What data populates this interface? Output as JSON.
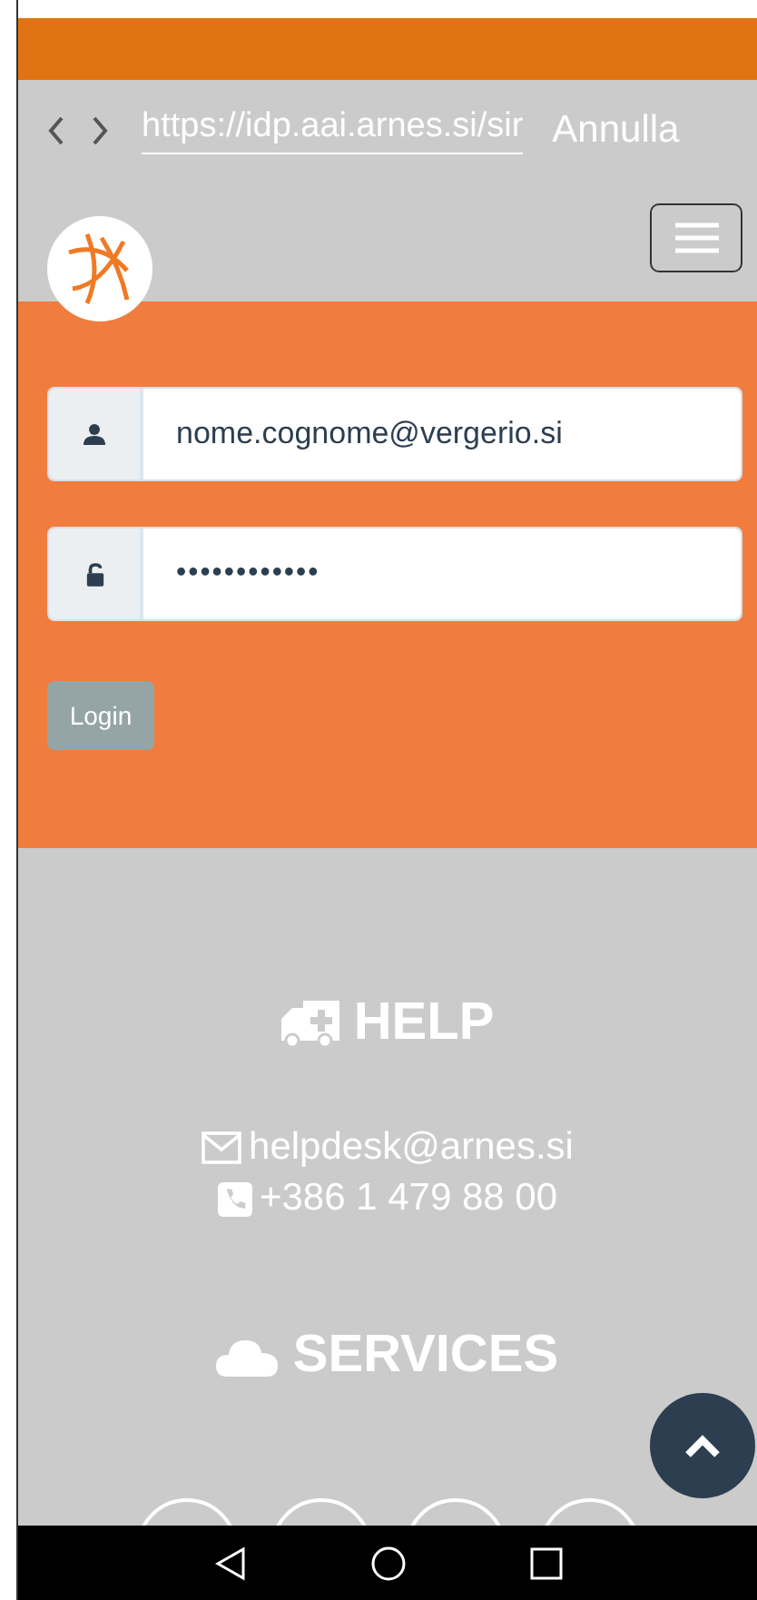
{
  "browser_bar": {
    "url": "https://idp.aai.arnes.si/sir",
    "cancel": "Annulla"
  },
  "login_form": {
    "username": {
      "value": "nome.cognome@vergerio.si"
    },
    "password": {
      "value": "••••••••••••"
    },
    "button": "Login"
  },
  "help": {
    "title": "HELP",
    "email": "helpdesk@arnes.si",
    "phone": "+386 1 479 88 00"
  },
  "services": {
    "title": "SERVICES",
    "items": [
      {
        "kind": "circle"
      },
      {
        "kind": "circle"
      },
      {
        "kind": "circle"
      },
      {
        "kind": "circle"
      }
    ]
  }
}
